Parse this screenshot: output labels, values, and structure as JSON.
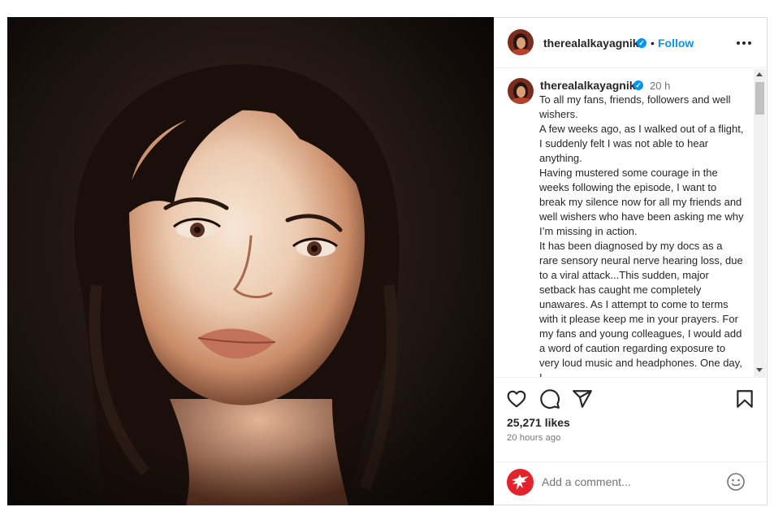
{
  "post": {
    "username": "therealalkayagnik",
    "follow_label": "Follow",
    "separator": "•",
    "verified_mark": "✓",
    "time_short": "20 h",
    "caption_paragraphs": [
      "To all my fans, friends, followers and well wishers.",
      "A few weeks ago, as I walked out of a flight, I suddenly felt I was not able to hear anything.",
      "Having mustered some courage in the weeks following the episode, I want to break my silence now for all my friends and well wishers who have been asking me why I’m missing in action.",
      "It has been diagnosed by my docs as a rare sensory neural nerve hearing loss, due to a viral attack...This sudden, major setback has caught me completely unawares. As I attempt to come to terms with it please keep me in your prayers. For my fans and young colleagues, I would add a word of caution regarding exposure to very loud music and headphones. One day, I"
    ],
    "likes": "25,271 likes",
    "time_ago": "20 hours ago",
    "comment_placeholder": "Add a comment..."
  },
  "icons": {
    "more": "more-options-icon",
    "like": "heart-icon",
    "comment": "comment-bubble-icon",
    "share": "paper-plane-icon",
    "save": "bookmark-icon",
    "emoji": "smiley-icon"
  },
  "colors": {
    "accent": "#0095f6",
    "text": "#262626",
    "muted": "#737373",
    "comment_avatar": "#e5212b"
  }
}
